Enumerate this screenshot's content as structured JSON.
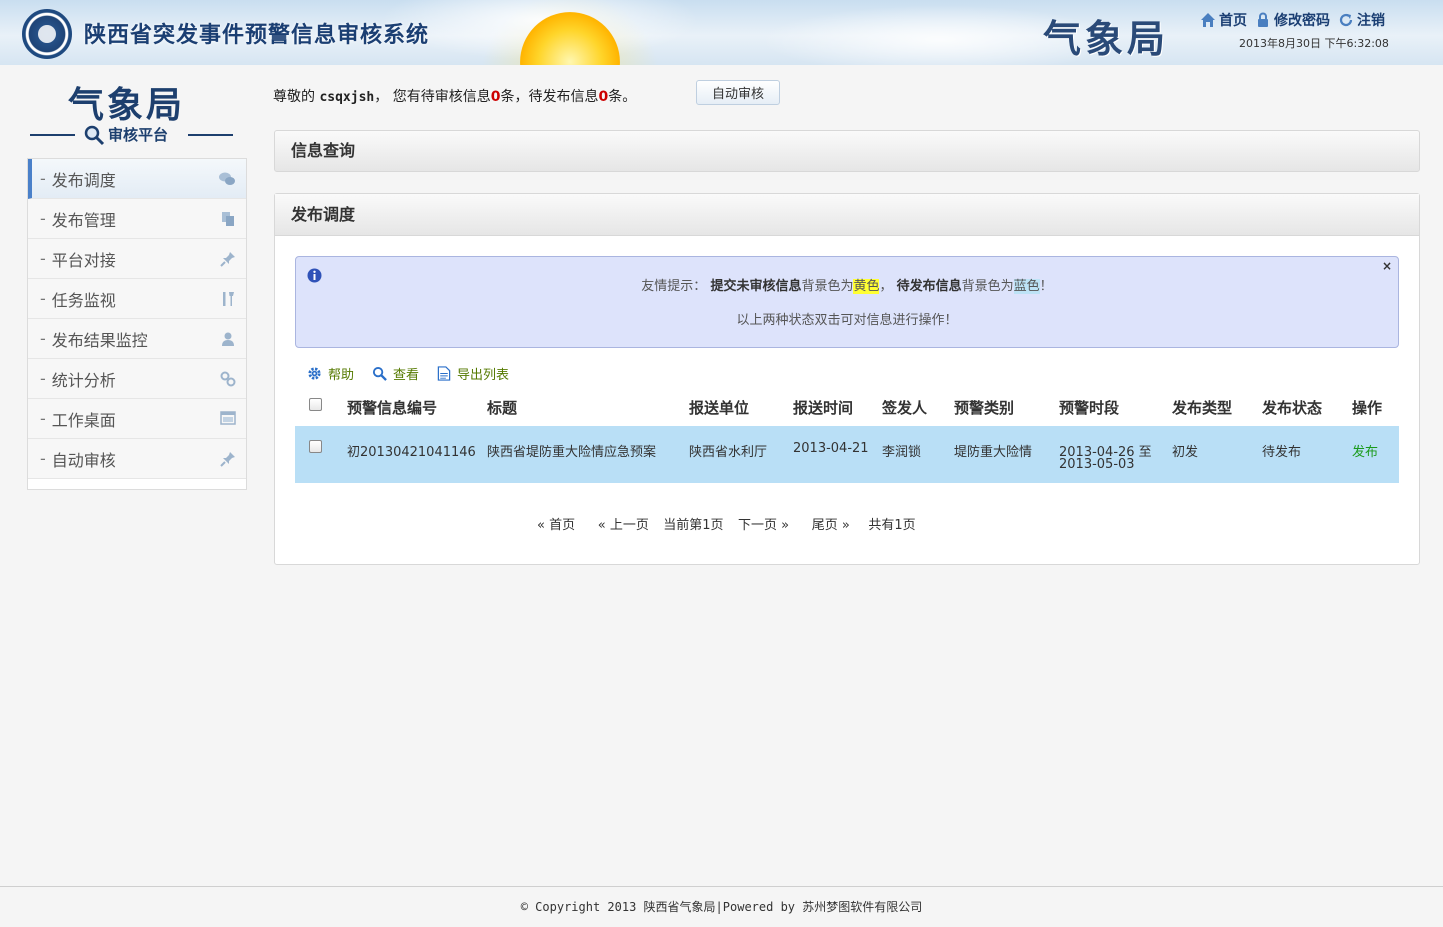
{
  "header": {
    "site_title": "陕西省突发事件预警信息审核系统",
    "bureau": "气象局",
    "links": {
      "home": "首页",
      "change_password": "修改密码",
      "logout": "注销"
    },
    "datetime": "2013年8月30日 下午6:32:08"
  },
  "sidebar": {
    "logo_main": "气象局",
    "logo_sub": "审核平台",
    "items": [
      {
        "label": "发布调度",
        "icon": "chat-bubbles-icon",
        "active": true
      },
      {
        "label": "发布管理",
        "icon": "documents-icon"
      },
      {
        "label": "平台对接",
        "icon": "pin-icon"
      },
      {
        "label": "任务监视",
        "icon": "tools-icon"
      },
      {
        "label": "发布结果监控",
        "icon": "user-icon"
      },
      {
        "label": "统计分析",
        "icon": "gears-icon"
      },
      {
        "label": "工作桌面",
        "icon": "window-icon"
      },
      {
        "label": "自动审核",
        "icon": "pin-icon"
      }
    ]
  },
  "greeting": {
    "prefix": "尊敬的 ",
    "user": "csqxjsh",
    "mid": "， 您有待审核信息",
    "pending_review": "0",
    "mid2": "条，待发布信息",
    "pending_publish": "0",
    "suffix": "条。"
  },
  "auto_review_button": "自动审核",
  "query_panel_title": "信息查询",
  "dispatch_panel_title": "发布调度",
  "tip": {
    "prefix": "友情提示： ",
    "submitted": "提交未审核信息",
    "bg_is": "背景色为",
    "yellow": "黄色",
    "sep": "， ",
    "to_publish": "待发布信息",
    "bg_is2": "背景色为",
    "blue": "蓝色",
    "end": "！",
    "line2": "以上两种状态双击可对信息进行操作！",
    "close": "×"
  },
  "toolbar": {
    "help": "帮助",
    "view": "查看",
    "export": "导出列表"
  },
  "table": {
    "headers": [
      "预警信息编号",
      "标题",
      "报送单位",
      "报送时间",
      "签发人",
      "预警类别",
      "预警时段",
      "发布类型",
      "发布状态",
      "操作"
    ],
    "rows": [
      {
        "id": "初20130421041146",
        "title": "陕西省堤防重大险情应急预案",
        "unit": "陕西省水利厅",
        "time": "2013-04-21",
        "signer": "李润锁",
        "category": "堤防重大险情",
        "period_1": "2013-04-26 至",
        "period_2": "2013-05-03",
        "type": "初发",
        "status": "待发布",
        "action": "发布"
      }
    ]
  },
  "pager": {
    "first": "« 首页",
    "prev": "« 上一页",
    "current": "当前第1页",
    "next": "下一页 »",
    "last": "尾页 »",
    "total": "共有1页"
  },
  "footer": "© Copyright 2013 陕西省气象局|Powered by 苏州梦图软件有限公司",
  "colors": {
    "accent": "#4a80c9",
    "row_highlight": "#b9dff6",
    "tip_bg": "#dde3fb",
    "count_red": "#cc0000"
  }
}
